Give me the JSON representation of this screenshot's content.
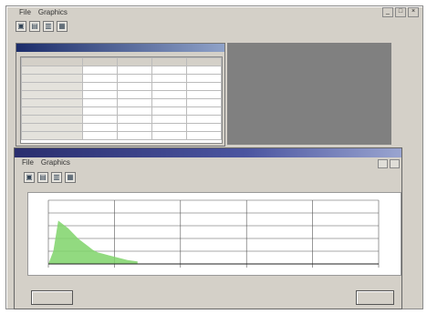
{
  "main_window": {
    "menu": [
      "File",
      "Graphics"
    ],
    "sys_controls": [
      "_",
      "□",
      "×"
    ],
    "toolbar_icons": [
      "open-icon",
      "chart-icon",
      "save-icon",
      "print-icon"
    ]
  },
  "data_window": {
    "title": "",
    "table": {
      "headers": [
        "",
        "",
        "",
        "",
        ""
      ],
      "rows": [
        [
          "",
          "",
          "",
          "",
          ""
        ],
        [
          "",
          "",
          "",
          "",
          ""
        ],
        [
          "",
          "",
          "",
          "",
          ""
        ],
        [
          "",
          "",
          "",
          "",
          ""
        ],
        [
          "",
          "",
          "",
          "",
          ""
        ],
        [
          "",
          "",
          "",
          "",
          ""
        ],
        [
          "",
          "",
          "",
          "",
          ""
        ],
        [
          "",
          "",
          "",
          "",
          ""
        ],
        [
          "",
          "",
          "",
          "",
          ""
        ]
      ]
    }
  },
  "graph_window": {
    "title": "",
    "menu": [
      "File",
      "Graphics"
    ],
    "toolbar_icons": [
      "open-icon",
      "chart-icon",
      "save-icon",
      "print-icon"
    ]
  },
  "chart_data": {
    "type": "area",
    "color": "#7fd46a",
    "x": [
      0,
      1,
      2,
      3,
      4,
      5,
      6,
      7,
      8,
      9,
      10,
      11,
      12,
      13,
      14,
      15,
      16,
      17,
      18
    ],
    "values": [
      0,
      100,
      340,
      310,
      280,
      240,
      200,
      170,
      140,
      110,
      90,
      80,
      70,
      60,
      50,
      40,
      30,
      25,
      20
    ],
    "xlim": [
      0,
      80
    ],
    "ylim": [
      0,
      500
    ],
    "ytick_values": [
      0,
      100,
      200,
      300,
      400,
      500
    ],
    "xtick_values": [
      0,
      16,
      32,
      48,
      64,
      80
    ],
    "grid": true
  },
  "buttons": {
    "left": "",
    "right": ""
  }
}
